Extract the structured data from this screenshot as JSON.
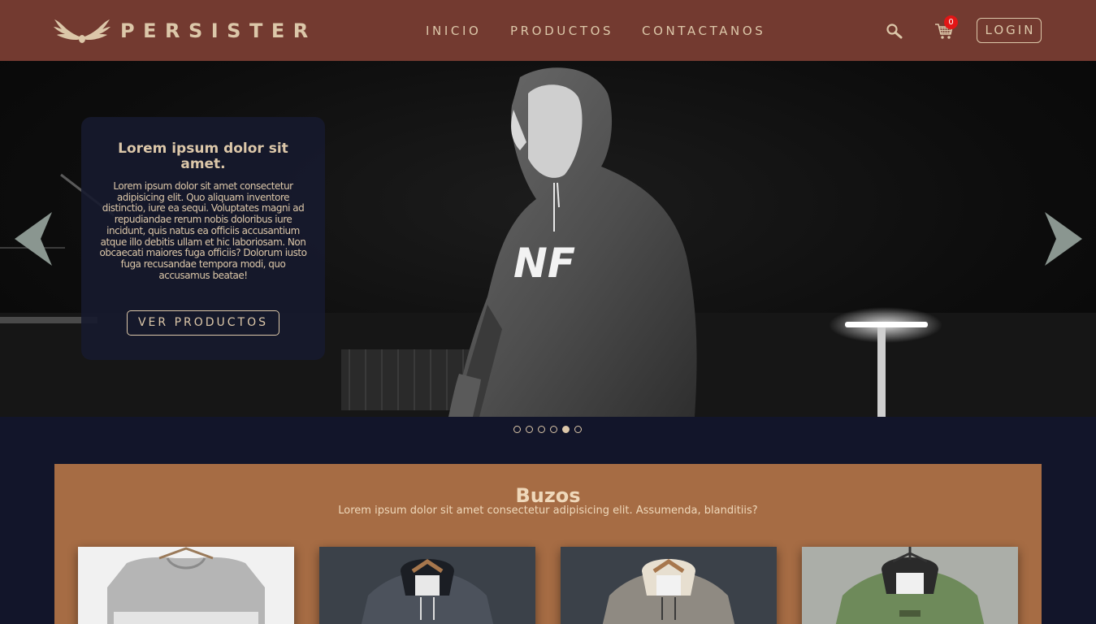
{
  "brand": {
    "name": "PERSISTER"
  },
  "nav": {
    "links": [
      "INICIO",
      "PRODUCTOS",
      "CONTACTANOS"
    ]
  },
  "header": {
    "cart_count": "0",
    "login_label": "LOGIN"
  },
  "hero": {
    "title": "Lorem ipsum dolor sit amet.",
    "body": "Lorem ipsum dolor sit amet consectetur adipisicing elit. Quo aliquam inventore distinctio, iure ea sequi. Voluptates magni ad repudiandae rerum nobis doloribus iure incidunt, quis natus ea officiis accusantium atque illo debitis ullam et hic laboriosam. Non obcaecati maiores fuga officiis? Dolorum iusto fuga recusandae tempora modi, quo accusamus beatae!",
    "button_label": "VER PRODUCTOS",
    "shirt_print": "NF",
    "slide_count": 6,
    "active_slide": 5
  },
  "section": {
    "title": "Buzos",
    "subtitle": "Lorem ipsum dolor sit amet consectetur adipisicing elit. Assumenda, blanditiis?"
  },
  "colors": {
    "header_bg": "#733a30",
    "accent_text": "#dcc7a9",
    "page_bg": "#12152a",
    "section_bg": "#a66c44",
    "badge": "#e21616"
  },
  "icons": [
    "wings-logo-icon",
    "search-icon",
    "cart-icon",
    "chevron-left-icon",
    "chevron-right-icon"
  ]
}
